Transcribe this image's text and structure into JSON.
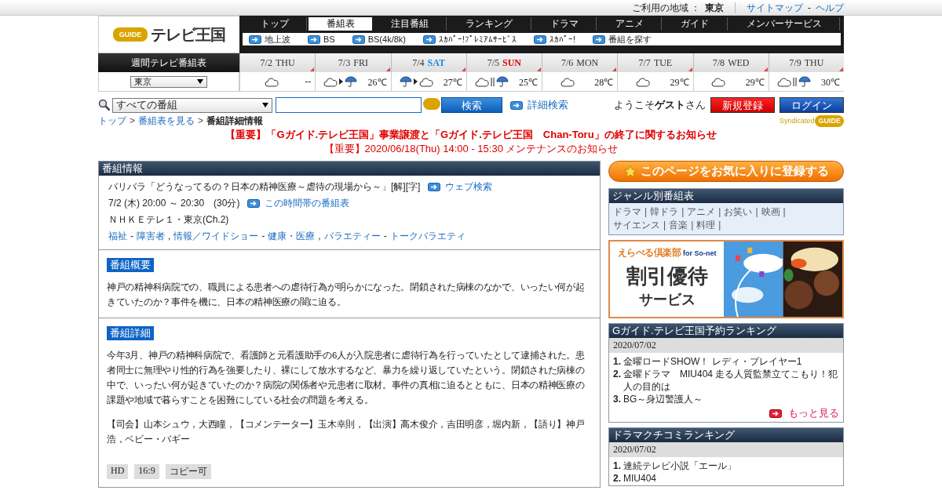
{
  "top_bar": {
    "region_label": "ご利用の地域 ：",
    "region": "東京",
    "links": [
      "サイトマップ",
      "ヘルプ"
    ],
    "link_separator": "-"
  },
  "logo": {
    "badge": "GUIDE",
    "name": "テレビ王国"
  },
  "nav": [
    {
      "label": "トップ",
      "selected": false
    },
    {
      "label": "番組表",
      "selected": true
    },
    {
      "label": "注目番組",
      "selected": false
    },
    {
      "label": "ランキング",
      "selected": false
    },
    {
      "label": "ドラマ",
      "selected": false
    },
    {
      "label": "アニメ",
      "selected": false
    },
    {
      "label": "ガイド",
      "selected": false
    },
    {
      "label": "メンバーサービス",
      "selected": false
    }
  ],
  "subnav": [
    "地上波",
    "BS",
    "BS(4k/8k)",
    "ｽｶﾊﾟｰ!ﾌﾟﾚﾐｱﾑｻｰﾋﾞｽ",
    "ｽｶﾊﾟｰ!",
    "番組を探す"
  ],
  "weekly": {
    "title": "週間テレビ番組表",
    "region_select": "東京",
    "days": [
      {
        "date": "7/2",
        "weekday": "THU",
        "weather": [
          {
            "kind": "cloud"
          }
        ],
        "temp": "--"
      },
      {
        "date": "7/3",
        "weekday": "FRI",
        "weather": [
          {
            "kind": "cloud"
          },
          {
            "kind": "then"
          },
          {
            "kind": "rain"
          }
        ],
        "temp": "26℃"
      },
      {
        "date": "7/4",
        "weekday": "SAT",
        "color": "#1a8ae0",
        "weather": [
          {
            "kind": "rain"
          },
          {
            "kind": "then"
          },
          {
            "kind": "cloud"
          }
        ],
        "temp": "27℃"
      },
      {
        "date": "7/5",
        "weekday": "SUN",
        "color": "#e00000",
        "weather": [
          {
            "kind": "cloud"
          },
          {
            "kind": "or"
          },
          {
            "kind": "rain"
          }
        ],
        "temp": "25℃"
      },
      {
        "date": "7/6",
        "weekday": "MON",
        "weather": [
          {
            "kind": "cloud"
          }
        ],
        "temp": "28℃"
      },
      {
        "date": "7/7",
        "weekday": "TUE",
        "weather": [
          {
            "kind": "cloud"
          }
        ],
        "temp": "29℃"
      },
      {
        "date": "7/8",
        "weekday": "WED",
        "weather": [
          {
            "kind": "cloud"
          }
        ],
        "temp": "29℃"
      },
      {
        "date": "7/9",
        "weekday": "THU",
        "weather": [
          {
            "kind": "cloud"
          },
          {
            "kind": "or"
          },
          {
            "kind": "rain"
          }
        ],
        "temp": "30℃"
      }
    ]
  },
  "search": {
    "category": "すべての番組",
    "button": "検索",
    "advanced": "詳細検索"
  },
  "user": {
    "welcome": "ようこそ**ゲスト**さん",
    "buttons": [
      {
        "label": "新規登録",
        "kind": "register"
      },
      {
        "label": "ログイン",
        "kind": "login"
      }
    ]
  },
  "breadcrumb": {
    "separator": ">",
    "items": [
      {
        "label": "トップ",
        "link": true
      },
      {
        "label": "番組表を見る",
        "link": true
      },
      {
        "label": "番組詳細情報",
        "link": false
      }
    ]
  },
  "syndicated": {
    "text": "Syndicated",
    "badge": "GUIDE"
  },
  "notices": [
    {
      "text": "【重要】「Gガイド.テレビ王国」事業譲渡と「Gガイド.テレビ王国　Chan-Toru」の終了に関するお知らせ",
      "bold": true
    },
    {
      "text": "【重要】2020/06/18(Thu) 14:00 - 15:30 メンテナンスのお知らせ",
      "bold": false
    }
  ],
  "program": {
    "header": "番組情報",
    "title": "バリバラ「どうなってるの？日本の精神医療～虐待の現場から～」[解][字]",
    "web_search": "ウェブ検索",
    "time": "7/2 (木) 20:00 ～ 20:30　(30分)",
    "timetable_link": "この時間帯の番組表",
    "channel": "ＮＨＫＥテレ１・東京(Ch.2)",
    "genre_joiner": "-",
    "genre_separator": ",",
    "genres": [
      {
        "main": "福祉",
        "sub": "障害者"
      },
      {
        "main": "情報／ワイドショー",
        "sub": "健康・医療"
      },
      {
        "main": "バラエティー",
        "sub": "トークバラエティ"
      }
    ],
    "sections": [
      {
        "label": "番組概要",
        "paragraphs": [
          "神戸の精神科病院での、職員による患者への虐待行為が明らかになった。閉鎖された病棟のなかで、いったい何が起きていたのか？事件を機に、日本の精神医療の闇に迫る。"
        ]
      },
      {
        "label": "番組詳細",
        "paragraphs": [
          "今年3月、神戸の精神科病院で、看護師と元看護助手の6人が入院患者に虐待行為を行っていたとして逮捕された。患者同士に無理やり性的行為を強要したり、裸にして放水するなど、暴力を繰り返していたという。閉鎖された病棟の中で、いったい何が起きていたのか？病院の関係者や元患者に取材。事件の真相に迫るとともに、日本の精神医療の課題や地域で暮らすことを困難にしている社会の問題を考える。",
          "【司会】山本シュウ，大西瞳，【コメンテーター】玉木幸則，【出演】高木俊介，吉田明彦，堀内新，【語り】神戸浩，ベビー・バギー"
        ],
        "tags": [
          "HD",
          "16:9",
          "コピー可"
        ]
      }
    ]
  },
  "favorite_button": "このページをお気に入りに登録する",
  "genre_box": {
    "title": "ジャンル別番組表",
    "separator": "|",
    "items": [
      "ドラマ",
      "韓ドラ",
      "アニメ",
      "お笑い",
      "映画",
      "サイエンス",
      "音楽",
      "料理"
    ]
  },
  "ad": {
    "brand": "えらべる倶楽部",
    "brand_suffix": "for So-net",
    "headline": "割引優待",
    "subline": "サービス"
  },
  "rankings": [
    {
      "title": "Gガイド.テレビ王国予約ランキング",
      "date": "2020/07/02",
      "items": [
        {
          "rank": "1.",
          "title": "金曜ロードSHOW！ レディ・プレイヤー1"
        },
        {
          "rank": "2.",
          "title": "金曜ドラマ　MIU404 走る人質監禁立てこもり！犯人の目的は"
        },
        {
          "rank": "3.",
          "title": "BG～身辺警護人～"
        }
      ],
      "more": "もっと見る"
    },
    {
      "title": "ドラマクチコミランキング",
      "date": "2020/07/02",
      "items": [
        {
          "rank": "1.",
          "title": "連続テレビ小説「エール」"
        },
        {
          "rank": "2.",
          "title": "MIU404"
        }
      ]
    }
  ]
}
